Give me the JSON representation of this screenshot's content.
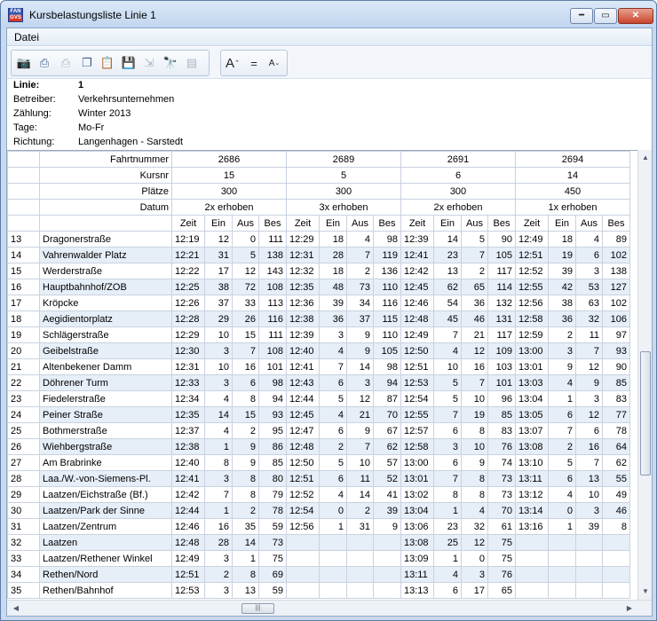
{
  "window": {
    "title": "Kursbelastungsliste Linie 1",
    "icon_top": "FAN",
    "icon_bottom": "GVS"
  },
  "menu": {
    "items": [
      "Datei"
    ]
  },
  "toolbar": {
    "icons": [
      "camera-icon",
      "print-icon",
      "print-preview-icon",
      "copy-icon",
      "paste-icon",
      "save-icon",
      "export-icon",
      "find-icon",
      "properties-icon"
    ],
    "format_icons": [
      "font-increase-icon",
      "font-reset-icon",
      "font-decrease-icon"
    ],
    "font_increase_label": "A",
    "font_reset_label": "=",
    "font_decrease_label": "A"
  },
  "info": [
    {
      "label": "Linie:",
      "value": "1",
      "bold": true
    },
    {
      "label": "Betreiber:",
      "value": "Verkehrsunternehmen"
    },
    {
      "label": "Zählung:",
      "value": "Winter 2013"
    },
    {
      "label": "Tage:",
      "value": "Mo-Fr"
    },
    {
      "label": "Richtung:",
      "value": "Langenhagen - Sarstedt"
    }
  ],
  "grid": {
    "header_labels": {
      "fahrt": "Fahrtnummer",
      "kurs": "Kursnr",
      "plaetze": "Plätze",
      "datum": "Datum"
    },
    "sub_headers": [
      "Zeit",
      "Ein",
      "Aus",
      "Bes"
    ],
    "trips": [
      {
        "fahrt": "2686",
        "kurs": "15",
        "plaetze": "300",
        "datum": "2x erhoben"
      },
      {
        "fahrt": "2689",
        "kurs": "5",
        "plaetze": "300",
        "datum": "3x erhoben"
      },
      {
        "fahrt": "2691",
        "kurs": "6",
        "plaetze": "300",
        "datum": "2x erhoben"
      },
      {
        "fahrt": "2694",
        "kurs": "14",
        "plaetze": "450",
        "datum": "1x erhoben"
      }
    ],
    "rows": [
      {
        "n": "13",
        "stop": "Dragonerstraße",
        "c": [
          [
            "12:19",
            "12",
            "0",
            "111"
          ],
          [
            "12:29",
            "18",
            "4",
            "98"
          ],
          [
            "12:39",
            "14",
            "5",
            "90"
          ],
          [
            "12:49",
            "18",
            "4",
            "89"
          ]
        ]
      },
      {
        "n": "14",
        "stop": "Vahrenwalder Platz",
        "c": [
          [
            "12:21",
            "31",
            "5",
            "138"
          ],
          [
            "12:31",
            "28",
            "7",
            "119"
          ],
          [
            "12:41",
            "23",
            "7",
            "105"
          ],
          [
            "12:51",
            "19",
            "6",
            "102"
          ]
        ]
      },
      {
        "n": "15",
        "stop": "Werderstraße",
        "c": [
          [
            "12:22",
            "17",
            "12",
            "143"
          ],
          [
            "12:32",
            "18",
            "2",
            "136"
          ],
          [
            "12:42",
            "13",
            "2",
            "117"
          ],
          [
            "12:52",
            "39",
            "3",
            "138"
          ]
        ]
      },
      {
        "n": "16",
        "stop": "Hauptbahnhof/ZOB",
        "c": [
          [
            "12:25",
            "38",
            "72",
            "108"
          ],
          [
            "12:35",
            "48",
            "73",
            "110"
          ],
          [
            "12:45",
            "62",
            "65",
            "114"
          ],
          [
            "12:55",
            "42",
            "53",
            "127"
          ]
        ]
      },
      {
        "n": "17",
        "stop": "Kröpcke",
        "c": [
          [
            "12:26",
            "37",
            "33",
            "113"
          ],
          [
            "12:36",
            "39",
            "34",
            "116"
          ],
          [
            "12:46",
            "54",
            "36",
            "132"
          ],
          [
            "12:56",
            "38",
            "63",
            "102"
          ]
        ]
      },
      {
        "n": "18",
        "stop": "Aegidientorplatz",
        "c": [
          [
            "12:28",
            "29",
            "26",
            "116"
          ],
          [
            "12:38",
            "36",
            "37",
            "115"
          ],
          [
            "12:48",
            "45",
            "46",
            "131"
          ],
          [
            "12:58",
            "36",
            "32",
            "106"
          ]
        ]
      },
      {
        "n": "19",
        "stop": "Schlägerstraße",
        "c": [
          [
            "12:29",
            "10",
            "15",
            "111"
          ],
          [
            "12:39",
            "3",
            "9",
            "110"
          ],
          [
            "12:49",
            "7",
            "21",
            "117"
          ],
          [
            "12:59",
            "2",
            "11",
            "97"
          ]
        ]
      },
      {
        "n": "20",
        "stop": "Geibelstraße",
        "c": [
          [
            "12:30",
            "3",
            "7",
            "108"
          ],
          [
            "12:40",
            "4",
            "9",
            "105"
          ],
          [
            "12:50",
            "4",
            "12",
            "109"
          ],
          [
            "13:00",
            "3",
            "7",
            "93"
          ]
        ]
      },
      {
        "n": "21",
        "stop": "Altenbekener Damm",
        "c": [
          [
            "12:31",
            "10",
            "16",
            "101"
          ],
          [
            "12:41",
            "7",
            "14",
            "98"
          ],
          [
            "12:51",
            "10",
            "16",
            "103"
          ],
          [
            "13:01",
            "9",
            "12",
            "90"
          ]
        ]
      },
      {
        "n": "22",
        "stop": "Döhrener Turm",
        "c": [
          [
            "12:33",
            "3",
            "6",
            "98"
          ],
          [
            "12:43",
            "6",
            "3",
            "94"
          ],
          [
            "12:53",
            "5",
            "7",
            "101"
          ],
          [
            "13:03",
            "4",
            "9",
            "85"
          ]
        ]
      },
      {
        "n": "23",
        "stop": "Fiedelerstraße",
        "c": [
          [
            "12:34",
            "4",
            "8",
            "94"
          ],
          [
            "12:44",
            "5",
            "12",
            "87"
          ],
          [
            "12:54",
            "5",
            "10",
            "96"
          ],
          [
            "13:04",
            "1",
            "3",
            "83"
          ]
        ]
      },
      {
        "n": "24",
        "stop": "Peiner Straße",
        "c": [
          [
            "12:35",
            "14",
            "15",
            "93"
          ],
          [
            "12:45",
            "4",
            "21",
            "70"
          ],
          [
            "12:55",
            "7",
            "19",
            "85"
          ],
          [
            "13:05",
            "6",
            "12",
            "77"
          ]
        ]
      },
      {
        "n": "25",
        "stop": "Bothmerstraße",
        "c": [
          [
            "12:37",
            "4",
            "2",
            "95"
          ],
          [
            "12:47",
            "6",
            "9",
            "67"
          ],
          [
            "12:57",
            "6",
            "8",
            "83"
          ],
          [
            "13:07",
            "7",
            "6",
            "78"
          ]
        ]
      },
      {
        "n": "26",
        "stop": "Wiehbergstraße",
        "c": [
          [
            "12:38",
            "1",
            "9",
            "86"
          ],
          [
            "12:48",
            "2",
            "7",
            "62"
          ],
          [
            "12:58",
            "3",
            "10",
            "76"
          ],
          [
            "13:08",
            "2",
            "16",
            "64"
          ]
        ]
      },
      {
        "n": "27",
        "stop": "Am Brabrinke",
        "c": [
          [
            "12:40",
            "8",
            "9",
            "85"
          ],
          [
            "12:50",
            "5",
            "10",
            "57"
          ],
          [
            "13:00",
            "6",
            "9",
            "74"
          ],
          [
            "13:10",
            "5",
            "7",
            "62"
          ]
        ]
      },
      {
        "n": "28",
        "stop": "Laa./W.-von-Siemens-Pl.",
        "c": [
          [
            "12:41",
            "3",
            "8",
            "80"
          ],
          [
            "12:51",
            "6",
            "11",
            "52"
          ],
          [
            "13:01",
            "7",
            "8",
            "73"
          ],
          [
            "13:11",
            "6",
            "13",
            "55"
          ]
        ]
      },
      {
        "n": "29",
        "stop": "Laatzen/Eichstraße (Bf.)",
        "c": [
          [
            "12:42",
            "7",
            "8",
            "79"
          ],
          [
            "12:52",
            "4",
            "14",
            "41"
          ],
          [
            "13:02",
            "8",
            "8",
            "73"
          ],
          [
            "13:12",
            "4",
            "10",
            "49"
          ]
        ]
      },
      {
        "n": "30",
        "stop": "Laatzen/Park der Sinne",
        "c": [
          [
            "12:44",
            "1",
            "2",
            "78"
          ],
          [
            "12:54",
            "0",
            "2",
            "39"
          ],
          [
            "13:04",
            "1",
            "4",
            "70"
          ],
          [
            "13:14",
            "0",
            "3",
            "46"
          ]
        ]
      },
      {
        "n": "31",
        "stop": "Laatzen/Zentrum",
        "c": [
          [
            "12:46",
            "16",
            "35",
            "59"
          ],
          [
            "12:56",
            "1",
            "31",
            "9"
          ],
          [
            "13:06",
            "23",
            "32",
            "61"
          ],
          [
            "13:16",
            "1",
            "39",
            "8"
          ]
        ]
      },
      {
        "n": "32",
        "stop": "Laatzen",
        "c": [
          [
            "12:48",
            "28",
            "14",
            "73"
          ],
          [
            "",
            "",
            "",
            ""
          ],
          [
            "13:08",
            "25",
            "12",
            "75"
          ],
          [
            "",
            "",
            "",
            ""
          ]
        ]
      },
      {
        "n": "33",
        "stop": "Laatzen/Rethener Winkel",
        "c": [
          [
            "12:49",
            "3",
            "1",
            "75"
          ],
          [
            "",
            "",
            "",
            ""
          ],
          [
            "13:09",
            "1",
            "0",
            "75"
          ],
          [
            "",
            "",
            "",
            ""
          ]
        ]
      },
      {
        "n": "34",
        "stop": "Rethen/Nord",
        "c": [
          [
            "12:51",
            "2",
            "8",
            "69"
          ],
          [
            "",
            "",
            "",
            ""
          ],
          [
            "13:11",
            "4",
            "3",
            "76"
          ],
          [
            "",
            "",
            "",
            ""
          ]
        ]
      },
      {
        "n": "35",
        "stop": "Rethen/Bahnhof",
        "c": [
          [
            "12:53",
            "3",
            "13",
            "59"
          ],
          [
            "",
            "",
            "",
            ""
          ],
          [
            "13:13",
            "6",
            "17",
            "65"
          ],
          [
            "",
            "",
            "",
            ""
          ]
        ]
      }
    ]
  },
  "scroll": {
    "vertical_up": "▲",
    "vertical_down": "▼",
    "horizontal_left": "◀",
    "horizontal_right": "▶",
    "thumb_grip": "|||"
  }
}
